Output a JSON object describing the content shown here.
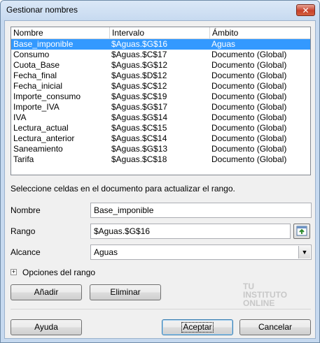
{
  "window": {
    "title": "Gestionar nombres",
    "close_label": "✕"
  },
  "list": {
    "columns": [
      "Nombre",
      "Intervalo",
      "Ámbito"
    ],
    "rows": [
      [
        "Base_imponible",
        "$Aguas.$G$16",
        "Aguas"
      ],
      [
        "Consumo",
        "$Aguas.$C$17",
        "Documento (Global)"
      ],
      [
        "Cuota_Base",
        "$Aguas.$G$12",
        "Documento (Global)"
      ],
      [
        "Fecha_final",
        "$Aguas.$D$12",
        "Documento (Global)"
      ],
      [
        "Fecha_inicial",
        "$Aguas.$C$12",
        "Documento (Global)"
      ],
      [
        "Importe_consumo",
        "$Aguas.$C$19",
        "Documento (Global)"
      ],
      [
        "Importe_IVA",
        "$Aguas.$G$17",
        "Documento (Global)"
      ],
      [
        "IVA",
        "$Aguas.$G$14",
        "Documento (Global)"
      ],
      [
        "Lectura_actual",
        "$Aguas.$C$15",
        "Documento (Global)"
      ],
      [
        "Lectura_anterior",
        "$Aguas.$C$14",
        "Documento (Global)"
      ],
      [
        "Saneamiento",
        "$Aguas.$G$13",
        "Documento (Global)"
      ],
      [
        "Tarifa",
        "$Aguas.$C$18",
        "Documento (Global)"
      ]
    ],
    "selected_index": 0
  },
  "hint": "Seleccione celdas en el documento para actualizar el rango.",
  "form": {
    "name_label": "Nombre",
    "name_value": "Base_imponible",
    "range_label": "Rango",
    "range_value": "$Aguas.$G$16",
    "scope_label": "Alcance",
    "scope_value": "Aguas",
    "options_label": "Opciones del rango",
    "options_expander": "+"
  },
  "buttons": {
    "add": "Añadir",
    "delete": "Eliminar",
    "help": "Ayuda",
    "ok": "Aceptar",
    "cancel": "Cancelar"
  },
  "watermark": [
    "TU",
    "INSTITUTO",
    "ONLINE"
  ],
  "colors": {
    "selection": "#3399ff",
    "dialog_bg": "#f0f0f0",
    "frame": "#c6d9ef"
  }
}
